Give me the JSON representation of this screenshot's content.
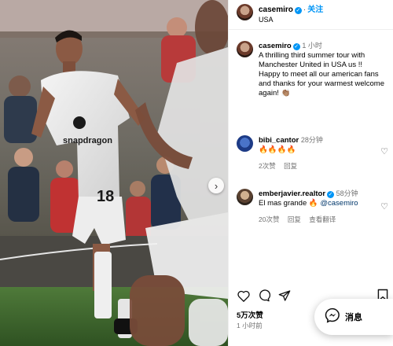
{
  "post_header": {
    "username": "casemiro",
    "follow_label": "关注",
    "location": "USA"
  },
  "caption": {
    "username": "casemiro",
    "time": "1 小时",
    "text": "A thrilling third summer tour with Manchester United in USA us !! Happy to meet all our american fans and thanks for your warmest welcome again! 👏🏽"
  },
  "comments": [
    {
      "username": "bibi_cantor",
      "time": "28分钟",
      "text": "🔥🔥🔥🔥",
      "likes": "2次赞",
      "reply_label": "回复"
    },
    {
      "username": "emberjavier.realtor",
      "time": "58分钟",
      "text_before": "El mas grande 🔥",
      "mention": "@casemiro",
      "likes": "20次赞",
      "reply_label": "回复",
      "translate_label": "查看翻译"
    }
  ],
  "post_stats": {
    "likes": "5万次赞",
    "date": "1 小时前"
  },
  "messages_button": {
    "label": "消息"
  },
  "photo": {
    "jersey_sponsor": "snapdragon",
    "jersey_number": "18"
  },
  "colors": {
    "verified": "#0095f6",
    "follow": "#0095f6",
    "pitch": "#3f6b2e"
  },
  "icons": [
    "verified-badge-icon",
    "heart-icon",
    "comment-icon",
    "share-icon",
    "save-icon",
    "messenger-icon",
    "chevron-right-icon"
  ]
}
